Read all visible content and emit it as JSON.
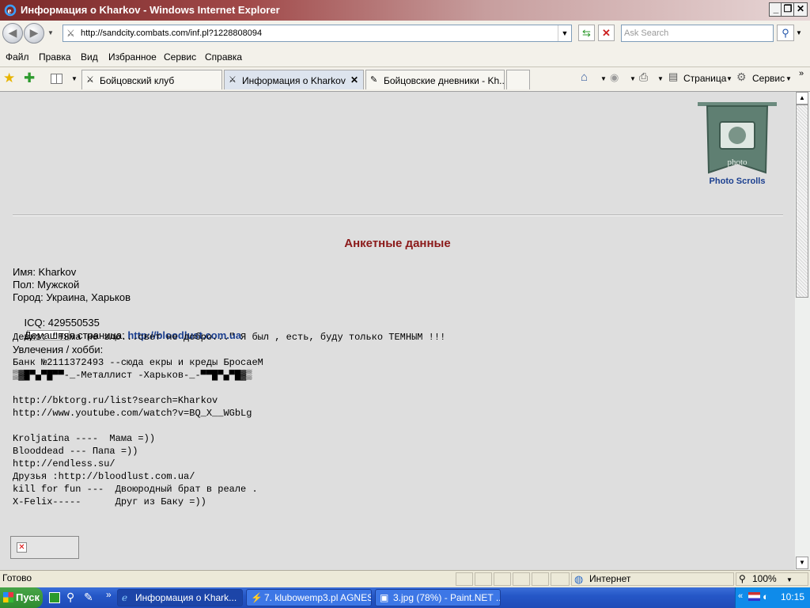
{
  "window": {
    "title": "Информация о Kharkov - Windows Internet Explorer"
  },
  "address": {
    "url": "http://sandcity.combats.com/inf.pl?1228808094",
    "search_placeholder": "Ask Search"
  },
  "menu": [
    "Файл",
    "Правка",
    "Вид",
    "Избранное",
    "Сервис",
    "Справка"
  ],
  "tabs": [
    {
      "label": "Бойцовский клуб"
    },
    {
      "label": "Информация о Kharkov"
    },
    {
      "label": "Бойцовские дневники - Kh..."
    }
  ],
  "commands": {
    "page": "Страница",
    "service": "Сервис"
  },
  "content": {
    "photo_scrolls": "Photo Scrolls",
    "photo_word": "photo",
    "heading": "Анкетные данные",
    "name": "Имя: Kharkov",
    "gender": "Пол: Мужской",
    "city": "Город: Украина, Харьков",
    "icq": "ICQ: 429550535",
    "homepage_label": "Домашняя страница: ",
    "homepage_link": "http://bloodlust.com.ua",
    "motto": "Девиз: \"Тьма не зло...свет не добро...\" Я был , есть, буду только ТЕМНЫМ !!!",
    "hobbies_label": "Увлечения / хобби:",
    "hobby_lines": [
      "Банк №2111372493 --сюда екры и креды БросаеМ",
      "▒▓█▀▄▀█▀▀-_-Металлист -Харьков-_-▀▀█▀▄▀█▓▒",
      "",
      "http://bktorg.ru/list?search=Kharkov",
      "http://www.youtube.com/watch?v=BQ_X__WGbLg",
      "",
      "Kroljatina ----  Мама =))",
      "Blooddead --- Папа =))",
      "http://endless.su/",
      "Друзья :http://bloodlust.com.ua/",
      "kill for fun ---  Двоюродный брат в реале .",
      "X-Felix-----      Друг из Баку =))"
    ]
  },
  "status": {
    "left": "Готово",
    "zone": "Интернет",
    "zoom": "100%"
  },
  "taskbar": {
    "start": "Пуск",
    "tasks": [
      "Информация о Khark...",
      "7. klubowemp3.pl AGNES...",
      "3.jpg (78%) - Paint.NET ..."
    ],
    "clock": "10:15"
  },
  "colors": {
    "heading": "#8b1a1a",
    "link": "#1b3f8f",
    "page_bg": "#dedede"
  }
}
